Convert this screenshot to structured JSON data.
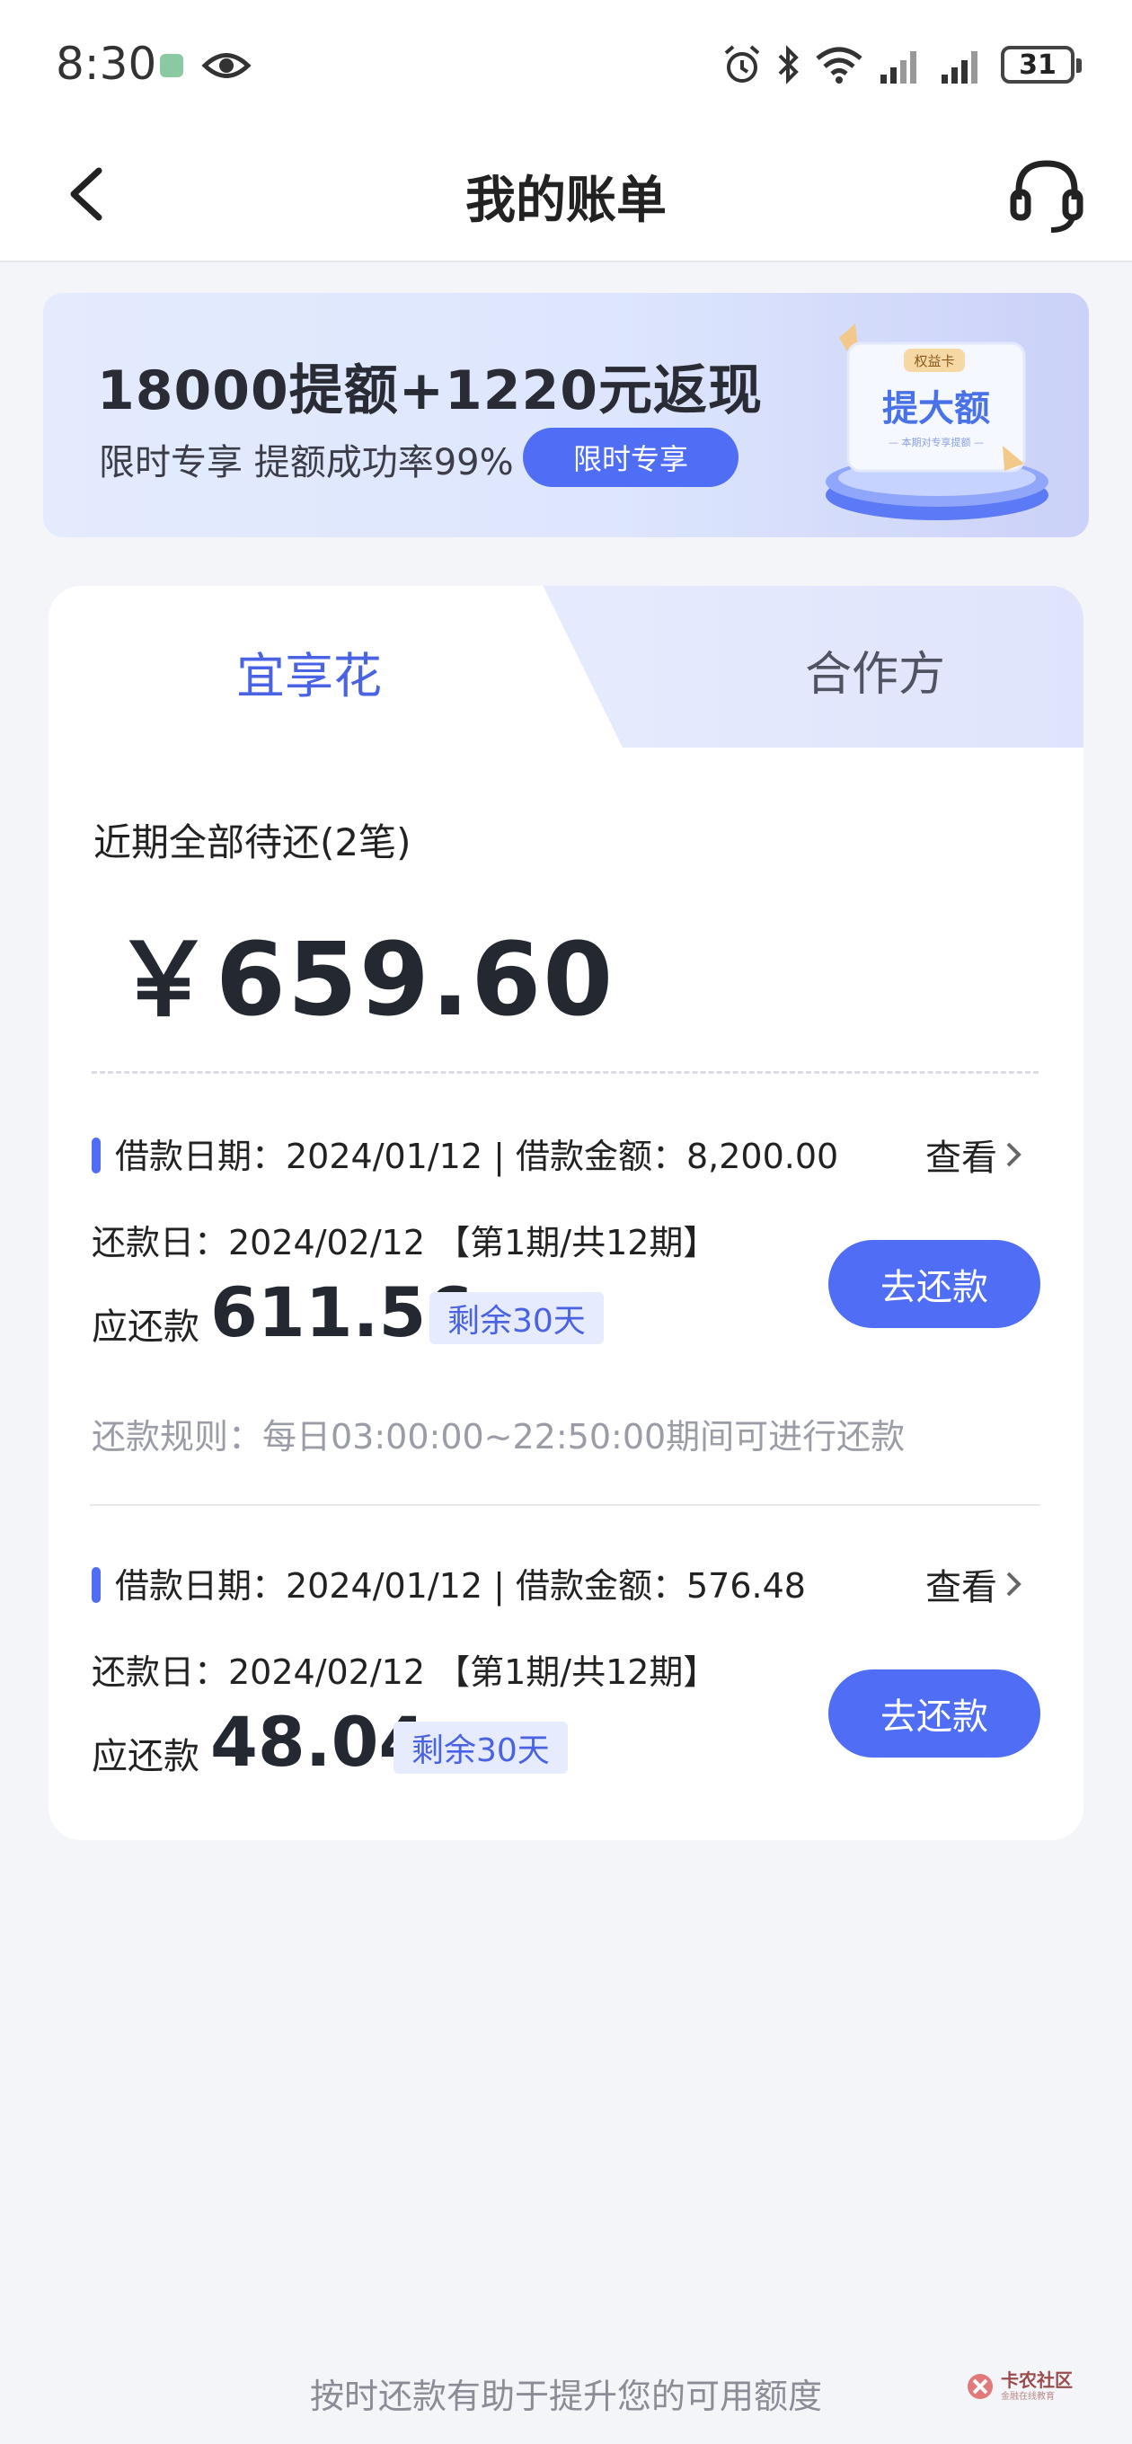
{
  "status_bar": {
    "time": "8:30",
    "battery": "31"
  },
  "nav": {
    "title": "我的账单"
  },
  "banner": {
    "title": "18000提额+1220元返现",
    "subtitle": "限时专享 提额成功率99%",
    "button_label": "限时专享",
    "card_badge": "权益卡",
    "card_title": "提大额",
    "card_caption": "— 本期对专享提额 —"
  },
  "tabs": [
    {
      "label": "宜享花",
      "active": true
    },
    {
      "label": "合作方",
      "active": false
    }
  ],
  "summary": {
    "title": "近期全部待还(2笔)",
    "amount": "￥659.60"
  },
  "loans": [
    {
      "info": "借款日期：2024/01/12 | 借款金额：8,200.00",
      "view_label": "查看",
      "repay_date": "还款日：2024/02/12 【第1期/共12期】",
      "due_label": "应还款",
      "due_amount": "611.56",
      "remaining": "剩余30天",
      "button_label": "去还款",
      "rule": "还款规则：每日03:00:00~22:50:00期间可进行还款"
    },
    {
      "info": "借款日期：2024/01/12 | 借款金额：576.48",
      "view_label": "查看",
      "repay_date": "还款日：2024/02/12 【第1期/共12期】",
      "due_label": "应还款",
      "due_amount": "48.04",
      "remaining": "剩余30天",
      "button_label": "去还款"
    }
  ],
  "footer": {
    "text": "按时还款有助于提升您的可用额度",
    "watermark_main": "卡农社区",
    "watermark_sub": "金融在线教育"
  },
  "colors": {
    "accent": "#4f6ef5",
    "accent_text": "#4a62e4",
    "background": "#f4f5f9"
  }
}
